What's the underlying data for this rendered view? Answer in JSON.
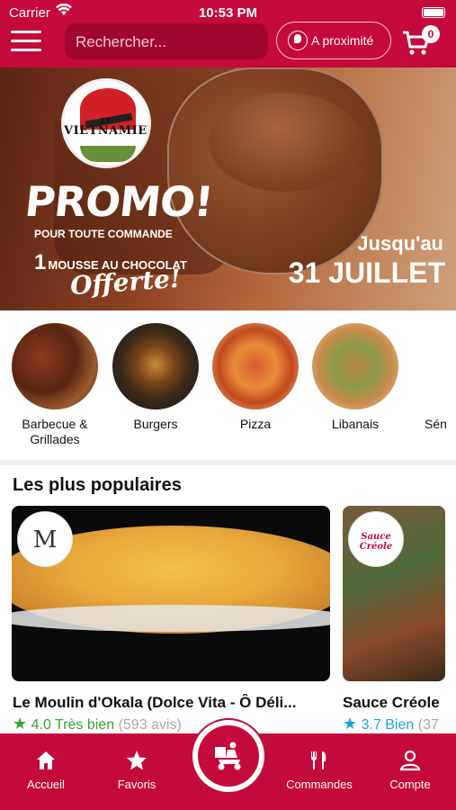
{
  "status_bar": {
    "carrier": "Carrier",
    "time": "10:53 PM"
  },
  "header": {
    "search_placeholder": "Rechercher...",
    "proximity_label": "A proximité",
    "cart_count": "0"
  },
  "banner": {
    "logo_text": "VIETNAMIEN",
    "logo_prefix": "LE",
    "title": "PROMO!",
    "line1": "POUR TOUTE COMMANDE",
    "line2_number": "1",
    "line2_text": "MOUSSE AU CHOCOLAT",
    "offer": "Offerte!",
    "until": "Jusqu'au",
    "date": "31 JUILLET"
  },
  "categories": [
    {
      "name": "Barbecue & Grillades"
    },
    {
      "name": "Burgers"
    },
    {
      "name": "Pizza"
    },
    {
      "name": "Libanais"
    },
    {
      "name": "Sén"
    }
  ],
  "popular": {
    "title": "Les plus populaires",
    "restaurants": [
      {
        "name": "Le Moulin d'Okala (Dolce Vita - Ô Déli...",
        "logo_text": "M",
        "star_color": "#3aa335",
        "rating": "4.0",
        "rating_label": "Très bien",
        "reviews": "(593 avis)"
      },
      {
        "name": "Sauce Créole",
        "logo_text": "Sauce Créole",
        "star_color": "#1aa3e0",
        "rating": "3.7",
        "rating_label": "Bien",
        "reviews": "(37"
      }
    ]
  },
  "bottom_nav": {
    "items": [
      {
        "label": "Accueil",
        "icon": "home-icon"
      },
      {
        "label": "Favoris",
        "icon": "star-icon"
      },
      {
        "label": "Commandes",
        "icon": "fork-knife-icon"
      },
      {
        "label": "Compte",
        "icon": "user-icon"
      }
    ],
    "center_icon": "delivery-scooter-icon"
  },
  "colors": {
    "brand": "#c40a3a",
    "rating_good": "#3aa335",
    "rating_ok": "#1aa3e0"
  }
}
